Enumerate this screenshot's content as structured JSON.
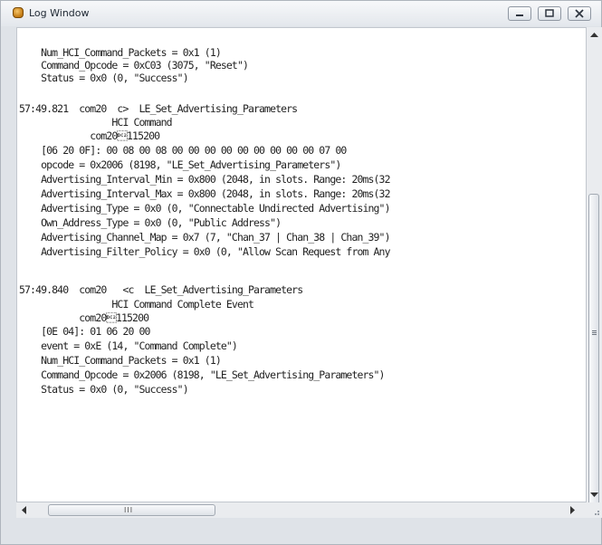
{
  "window": {
    "title": "Log Window"
  },
  "controls": {
    "minimize_icon": "minimize-icon",
    "maximize_icon": "maximize-icon",
    "close_icon": "close-icon"
  },
  "log": {
    "lines": [
      "    Num_HCI_Command_Packets = 0x1 (1)",
      "    Command_Opcode = 0xC03 (3075, \"Reset\")",
      "    Status = 0x0 (0, \"Success\")",
      "",
      "57:49.821  com20  c>  LE_Set_Advertising_Parameters",
      "                 HCI Command",
      "             com20\u0012115200",
      "    [06 20 0F]: 00 08 00 08 00 00 00 00 00 00 00 00 00 07 00",
      "    opcode = 0x2006 (8198, \"LE_Set_Advertising_Parameters\")",
      "    Advertising_Interval_Min = 0x800 (2048, in slots. Range: 20ms(32",
      "    Advertising_Interval_Max = 0x800 (2048, in slots. Range: 20ms(32",
      "    Advertising_Type = 0x0 (0, \"Connectable Undirected Advertising\")",
      "    Own_Address_Type = 0x0 (0, \"Public Address\")",
      "    Advertising_Channel_Map = 0x7 (7, \"Chan_37 | Chan_38 | Chan_39\")",
      "    Advertising_Filter_Policy = 0x0 (0, \"Allow Scan Request from Any",
      "",
      "57:49.840  com20   <c  LE_Set_Advertising_Parameters",
      "                 HCI Command Complete Event",
      "           com20\u0012115200",
      "    [0E 04]: 01 06 20 00",
      "    event = 0xE (14, \"Command Complete\")",
      "    Num_HCI_Command_Packets = 0x1 (1)",
      "    Command_Opcode = 0x2006 (8198, \"LE_Set_Advertising_Parameters\")",
      "    Status = 0x0 (0, \"Success\")"
    ]
  },
  "scrollbar": {
    "h_grip": "III"
  }
}
